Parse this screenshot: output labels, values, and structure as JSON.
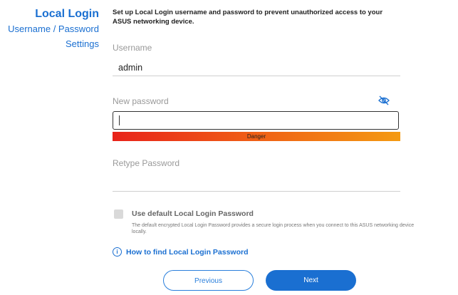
{
  "sidebar": {
    "title": "Local Login",
    "subtitle_line1": "Username / Password",
    "subtitle_line2": "Settings"
  },
  "form": {
    "intro": "Set up Local Login username and password to prevent unauthorized access to your ASUS networking device.",
    "username_label": "Username",
    "username_value": "admin",
    "new_password_label": "New password",
    "new_password_value": "",
    "strength_text": "Danger",
    "retype_label": "Retype Password",
    "retype_value": "",
    "use_default_label": "Use default Local Login Password",
    "use_default_desc": "The default encrypted Local Login Password provides a secure login process when you connect to this ASUS networking device locally.",
    "help_link": "How to find Local Login Password"
  },
  "buttons": {
    "previous": "Previous",
    "next": "Next"
  },
  "colors": {
    "accent": "#1a6fd1",
    "danger_start": "#e8231a",
    "danger_end": "#f49a12"
  }
}
